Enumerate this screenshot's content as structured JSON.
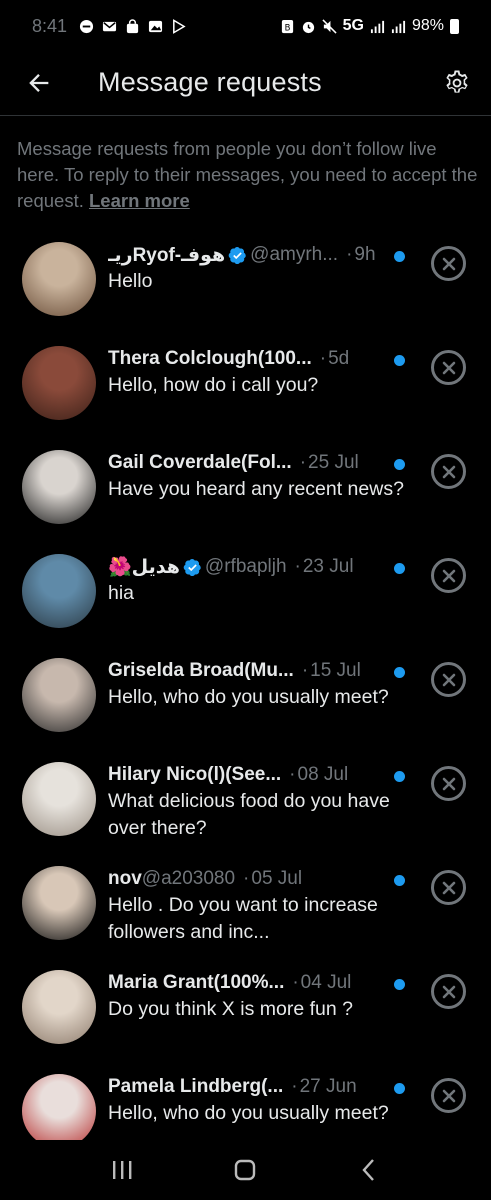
{
  "status_bar": {
    "time": "8:41",
    "network": "5G",
    "battery": "98%"
  },
  "header": {
    "title": "Message requests",
    "back_icon": "arrow-left-icon",
    "settings_icon": "gear-icon"
  },
  "info": {
    "text": "Message requests from people you don’t follow live here. To reply to their messages, you need to accept the request. ",
    "link": "Learn more"
  },
  "colors": {
    "background": "#000000",
    "text_primary": "#e7e9ea",
    "text_secondary": "#71767b",
    "accent_blue": "#1d9bf0"
  },
  "requests": [
    {
      "name": "ريـRyof-هوفـ",
      "verified": true,
      "handle": "@amyrh...",
      "time": "9h",
      "message": "Hello",
      "unread": true,
      "avatar_colors": [
        "#c9b39c",
        "#6b4f3a"
      ]
    },
    {
      "name": "Thera Colclough(100...",
      "verified": false,
      "handle": "",
      "time": "5d",
      "message": "Hello, how do i call you?",
      "unread": true,
      "avatar_colors": [
        "#8a4a3a",
        "#3b2018"
      ]
    },
    {
      "name": "Gail Coverdale(Fol...",
      "verified": false,
      "handle": "",
      "time": "25 Jul",
      "message": "Have you heard any recent news?",
      "unread": true,
      "avatar_colors": [
        "#d9d4cf",
        "#1a1a1a"
      ]
    },
    {
      "name": "🌺هديل",
      "verified": true,
      "handle": "@rfbapljh",
      "time": "23 Jul",
      "message": "hia",
      "unread": true,
      "avatar_colors": [
        "#5f8aa8",
        "#2b3a44"
      ]
    },
    {
      "name": "Griselda Broad(Mu...",
      "verified": false,
      "handle": "",
      "time": "15 Jul",
      "message": "Hello, who do you usually meet?",
      "unread": true,
      "avatar_colors": [
        "#c7b8ad",
        "#2a2a2a"
      ]
    },
    {
      "name": "Hilary Nico(l)(See...",
      "verified": false,
      "handle": "",
      "time": "08 Jul",
      "message": "What delicious food do you have over there?",
      "unread": true,
      "avatar_colors": [
        "#e6e2dc",
        "#9a8f84"
      ]
    },
    {
      "name": "nov",
      "verified": false,
      "handle": "@a203080",
      "time": "05 Jul",
      "message": "Hello . Do you want to increase followers and inc...",
      "unread": true,
      "avatar_colors": [
        "#d8c7b7",
        "#111111"
      ]
    },
    {
      "name": "Maria Grant(100%...",
      "verified": false,
      "handle": "",
      "time": "04 Jul",
      "message": "Do you think X is more fun ?",
      "unread": true,
      "avatar_colors": [
        "#e2d6c9",
        "#8c7a6b"
      ]
    },
    {
      "name": "Pamela Lindberg(...",
      "verified": false,
      "handle": "",
      "time": "27 Jun",
      "message": "Hello, who do you usually meet?",
      "unread": true,
      "avatar_colors": [
        "#e9dedb",
        "#b52a2a"
      ]
    }
  ],
  "nav": {
    "recents_icon": "recents-icon",
    "home_icon": "home-icon",
    "back_icon": "back-chevron-icon"
  }
}
